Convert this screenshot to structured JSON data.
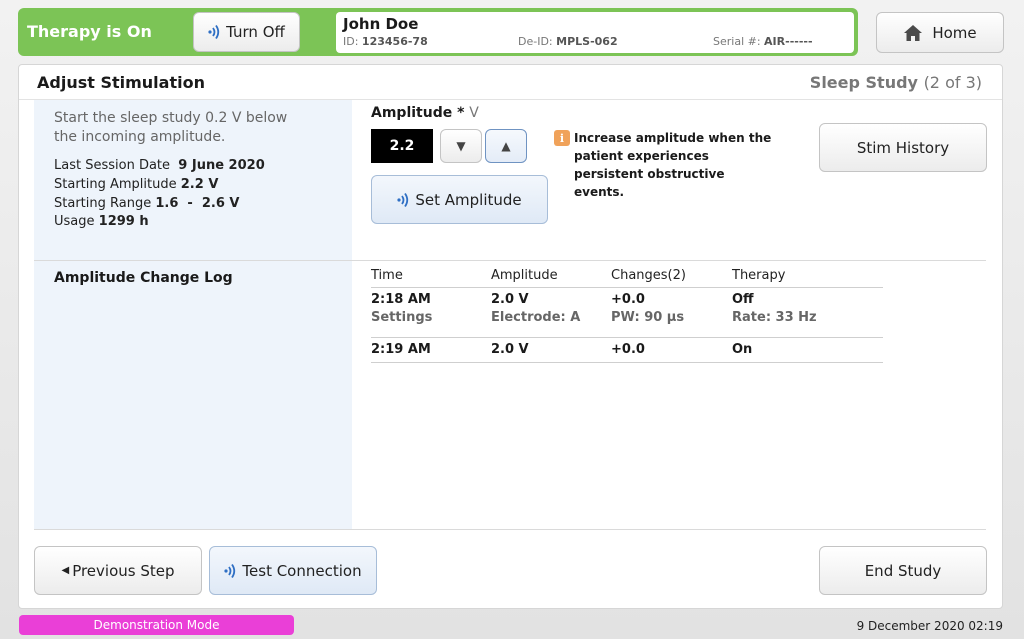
{
  "header": {
    "therapy_status": "Therapy is On",
    "turn_off_label": "Turn Off",
    "home_label": "Home",
    "patient": {
      "name": "John Doe",
      "id_label": "ID:",
      "id_value": "123456-78",
      "deid_label": "De-ID:",
      "deid_value": "MPLS-062",
      "serial_label": "Serial #:",
      "serial_value": "AIR------"
    }
  },
  "panel": {
    "title": "Adjust Stimulation",
    "step_name": "Sleep Study",
    "step_count": "(2 of 3)"
  },
  "left": {
    "instruction": "Start the sleep study 0.2 V below the incoming amplitude.",
    "last_session_label": "Last Session Date",
    "last_session_value": "9 June 2020",
    "starting_amp_label": "Starting Amplitude",
    "starting_amp_value": "2.2 V",
    "starting_range_label": "Starting Range",
    "starting_range_value": "1.6  -  2.6 V",
    "usage_label": "Usage",
    "usage_value": "1299 h"
  },
  "amplitude": {
    "label": "Amplitude *",
    "unit": "V",
    "value": "2.2",
    "set_label": "Set Amplitude",
    "hint_icon": "i",
    "hint": "Increase amplitude when the patient experiences persistent obstructive events."
  },
  "stim_history_label": "Stim History",
  "log": {
    "title": "Amplitude Change Log",
    "headers": [
      "Time",
      "Amplitude",
      "Changes(2)",
      "Therapy"
    ],
    "entries": [
      {
        "main": [
          "2:18 AM",
          "2.0 V",
          "+0.0",
          "Off"
        ],
        "sub": [
          "Settings",
          "Electrode: A",
          "PW: 90 µs",
          "Rate: 33 Hz"
        ]
      },
      {
        "main": [
          "2:19 AM",
          "2.0 V",
          "+0.0",
          "On"
        ]
      }
    ]
  },
  "footer_buttons": {
    "previous_label": "Previous Step",
    "test_connection_label": "Test Connection",
    "end_study_label": "End Study"
  },
  "footer": {
    "mode": "Demonstration Mode",
    "datetime": "9 December 2020 02:19"
  },
  "colors": {
    "therapy_green": "#7cc456",
    "wireless_blue": "#2f6fc4",
    "demo_magenta": "#ea3fd7",
    "hint_orange": "#f0a25a"
  }
}
